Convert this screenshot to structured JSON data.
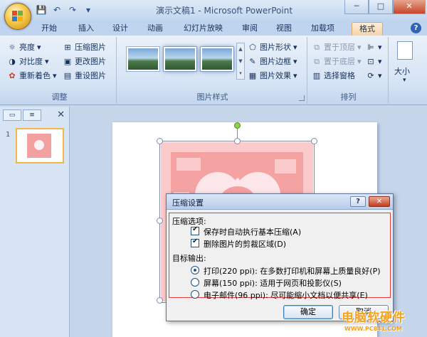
{
  "window": {
    "title": "演示文稿1 - Microsoft PowerPoint",
    "controls": {
      "minimize": "─",
      "maximize": "□",
      "close": "✕"
    }
  },
  "qat": {
    "save": "💾",
    "undo": "↶",
    "redo": "↷",
    "customize": "▾"
  },
  "tabs": [
    {
      "label": "开始"
    },
    {
      "label": "插入"
    },
    {
      "label": "设计"
    },
    {
      "label": "动画"
    },
    {
      "label": "幻灯片放映"
    },
    {
      "label": "审阅"
    },
    {
      "label": "视图"
    },
    {
      "label": "加载项"
    },
    {
      "label": "格式",
      "active": true
    }
  ],
  "help": "?",
  "ribbon": {
    "adjust": {
      "label": "调整",
      "brightness": "亮度",
      "contrast": "对比度",
      "recolor": "重新着色",
      "compress": "压缩图片",
      "change": "更改图片",
      "reset": "重设图片"
    },
    "styles": {
      "label": "图片样式",
      "shape": "图片形状",
      "border": "图片边框",
      "effects": "图片效果"
    },
    "arrange": {
      "label": "排列",
      "bring_front": "置于顶层",
      "send_back": "置于底层",
      "selection_pane": "选择窗格"
    },
    "size": {
      "label": "大小"
    }
  },
  "slide_pane": {
    "slide_number": "1"
  },
  "dialog": {
    "title": "压缩设置",
    "help": "?",
    "close": "✕",
    "compress_options_label": "压缩选项:",
    "option_auto": "保存时自动执行基本压缩(A)",
    "option_crop": "删除图片的剪裁区域(D)",
    "target_label": "目标输出:",
    "target_print": "打印(220 ppi): 在多数打印机和屏幕上质量良好(P)",
    "target_screen": "屏幕(150 ppi): 适用于网页和投影仪(S)",
    "target_email": "电子邮件(96 ppi): 尽可能缩小文档以便共享(E)",
    "ok": "确定",
    "cancel": "取消"
  },
  "watermark": {
    "big": "电脑软硬件",
    "small": "WWW.PC841.COM"
  }
}
